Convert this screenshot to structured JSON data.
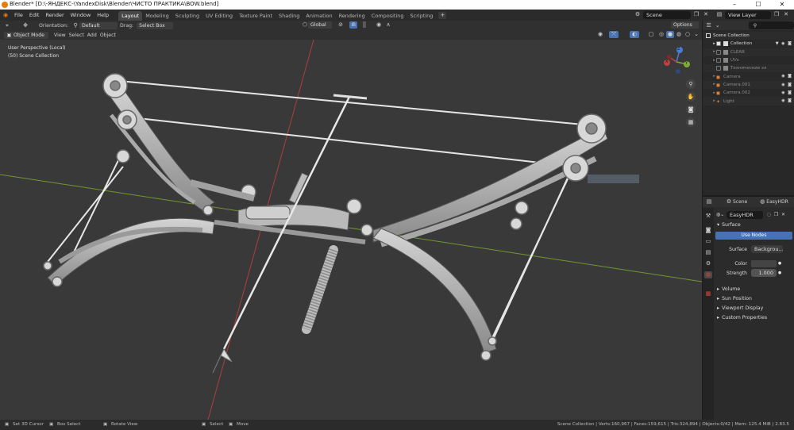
{
  "window": {
    "title": "Blender* [D:\\-ЯНДЕКС-\\YandexDisk\\Blender\\ЧИСТО ПРАКТИКА\\BOW.blend]",
    "min": "–",
    "max": "☐",
    "close": "✕"
  },
  "menu": [
    "File",
    "Edit",
    "Render",
    "Window",
    "Help"
  ],
  "workspaces": [
    {
      "label": "Layout",
      "active": true
    },
    {
      "label": "Modeling"
    },
    {
      "label": "Sculpting"
    },
    {
      "label": "UV Editing"
    },
    {
      "label": "Texture Paint"
    },
    {
      "label": "Shading"
    },
    {
      "label": "Animation"
    },
    {
      "label": "Rendering"
    },
    {
      "label": "Compositing"
    },
    {
      "label": "Scripting"
    }
  ],
  "top_right": {
    "scene": "Scene",
    "view_layer": "View Layer"
  },
  "tool_header": {
    "orientation_label": "Orientation:",
    "orientation_value": "Default",
    "drag_label": "Drag:",
    "drag_value": "Select Box",
    "transform": "Global",
    "options": "Options"
  },
  "viewport_header": {
    "mode": "Object Mode",
    "menus": [
      "View",
      "Select",
      "Add",
      "Object"
    ]
  },
  "viewport": {
    "perspective": "User Perspective (Local)",
    "collection": "(50) Scene Collection"
  },
  "gizmo": {
    "x": "X",
    "y": "Y",
    "z": "Z"
  },
  "outliner": {
    "search_placeholder": "",
    "items": [
      {
        "label": "Scene Collection",
        "indent": 0,
        "icon": "scene-collection-icon",
        "dim": false
      },
      {
        "label": "Collection",
        "indent": 1,
        "icon": "collection-icon",
        "dim": false
      },
      {
        "label": "CLEAR",
        "indent": 1,
        "icon": "collection-icon",
        "dim": true
      },
      {
        "label": "UVs",
        "indent": 1,
        "icon": "collection-icon",
        "dim": true
      },
      {
        "label": "Технические эл",
        "indent": 1,
        "icon": "collection-icon",
        "dim": true
      },
      {
        "label": "Camera",
        "indent": 1,
        "icon": "camera-icon",
        "dim": true
      },
      {
        "label": "Camera.001",
        "indent": 1,
        "icon": "camera-icon",
        "dim": true
      },
      {
        "label": "Camera.002",
        "indent": 1,
        "icon": "camera-icon",
        "dim": true
      },
      {
        "label": "Light",
        "indent": 1,
        "icon": "light-icon",
        "dim": true
      }
    ]
  },
  "properties": {
    "scene_tab": "Scene",
    "world_tab": "EasyHDR",
    "world_name": "EasyHDR",
    "surface_section": "Surface",
    "use_nodes": "Use Nodes",
    "surface_label": "Surface",
    "surface_value": "Backgrou...",
    "color_label": "Color",
    "strength_label": "Strength",
    "strength_value": "1.000",
    "sections": [
      "Volume",
      "Sun Position",
      "Viewport Display",
      "Custom Properties"
    ]
  },
  "status": {
    "cursor": "Set 3D Cursor",
    "box": "Box Select",
    "rotate": "Rotate View",
    "select": "Select",
    "move": "Move",
    "stats": "Scene Collection | Verts:160,967 | Faces:159,615 | Tris:324,894 | Objects:0/42 | Mem: 125.4 MiB | 2.83.5"
  },
  "colors": {
    "accent": "#4772b3",
    "active_tab": "#474747",
    "viewport_bg": "#393939",
    "axis_x": "#c0413f",
    "axis_y": "#7fae2f",
    "axis_z": "#4a7bd8"
  }
}
